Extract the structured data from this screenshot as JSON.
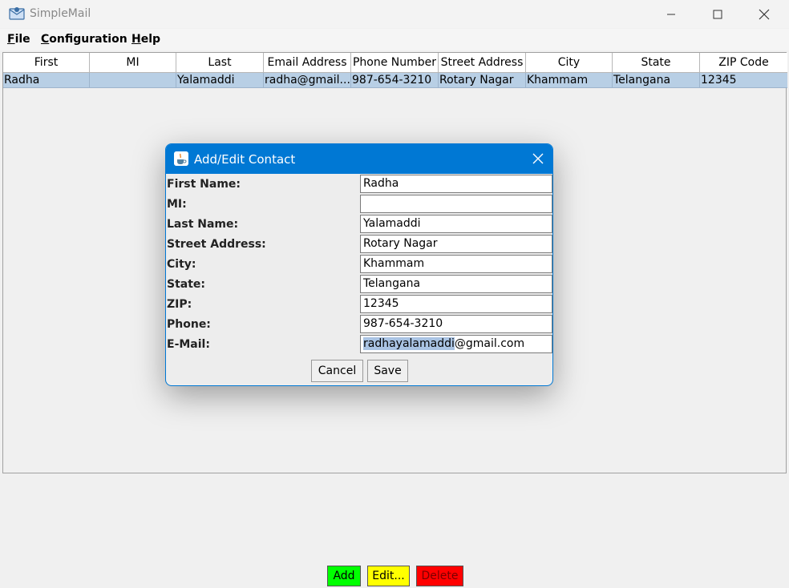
{
  "window": {
    "title": "SimpleMail"
  },
  "menu": [
    {
      "underline": "F",
      "rest": "ile"
    },
    {
      "underline": "C",
      "rest": "onfiguration"
    },
    {
      "underline": "H",
      "rest": "elp"
    }
  ],
  "table": {
    "columns": [
      "First",
      "MI",
      "Last",
      "Email Address",
      "Phone Number",
      "Street Address",
      "City",
      "State",
      "ZIP Code"
    ],
    "rows": [
      [
        "Radha",
        "",
        "Yalamaddi",
        "radha@gmail....",
        "987-654-3210",
        "Rotary Nagar",
        "Khammam",
        "Telangana",
        "12345"
      ]
    ]
  },
  "buttons": {
    "add": "Add",
    "edit": "Edit...",
    "delete": "Delete"
  },
  "colors": {
    "add": "#00ff00",
    "edit": "#ffff00",
    "delete": "#ff0000",
    "accent": "#0078d4",
    "selection": "#b8cfe5"
  },
  "dialog": {
    "title": "Add/Edit Contact",
    "fields": [
      {
        "label": "First Name:",
        "value": "Radha"
      },
      {
        "label": "MI:",
        "value": ""
      },
      {
        "label": "Last Name:",
        "value": "Yalamaddi"
      },
      {
        "label": "Street Address:",
        "value": "Rotary Nagar"
      },
      {
        "label": "City:",
        "value": "Khammam"
      },
      {
        "label": "State:",
        "value": "Telangana"
      },
      {
        "label": "ZIP:",
        "value": "12345"
      },
      {
        "label": "Phone:",
        "value": "987-654-3210"
      },
      {
        "label": "E-Mail:",
        "value_selected": "radhayalamaddi",
        "value_rest": "@gmail.com"
      }
    ],
    "cancel": "Cancel",
    "save": "Save"
  }
}
